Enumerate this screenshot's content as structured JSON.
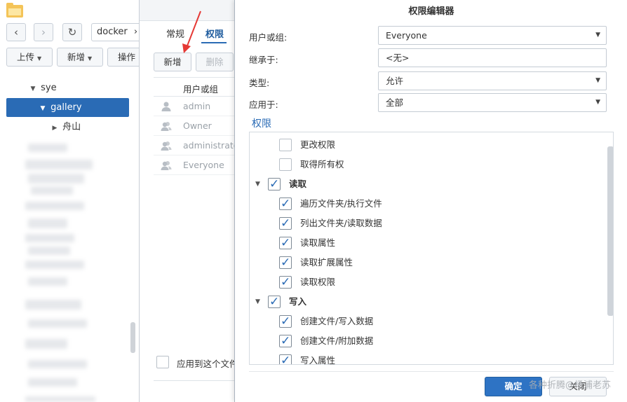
{
  "file_station": {
    "path_text": "docker",
    "path_chevron": "›",
    "back_icon": "‹",
    "forward_icon": "›",
    "refresh_icon": "↻",
    "toolbar": {
      "upload_label": "上传",
      "new_label": "新增",
      "action_label": "操作"
    },
    "tree": [
      {
        "label": "sye",
        "expanded": true
      },
      {
        "label": "gallery",
        "expanded": true,
        "selected": true
      },
      {
        "label": "舟山",
        "expanded": false
      }
    ]
  },
  "property_window": {
    "tabs": [
      {
        "label": "常规"
      },
      {
        "label": "权限",
        "active": true
      }
    ],
    "buttons": {
      "add_label": "新增",
      "delete_label": "删除"
    },
    "column_header": "用户或组",
    "users": [
      "admin",
      "Owner",
      "administrato",
      "Everyone"
    ],
    "apply_label": "应用到这个文件"
  },
  "permission_editor": {
    "title": "权限编辑器",
    "fields": {
      "user_or_group": {
        "label": "用户或组:",
        "value": "Everyone"
      },
      "inherit_from": {
        "label": "继承于:",
        "value": "<无>"
      },
      "type": {
        "label": "类型:",
        "value": "允许"
      },
      "apply_to": {
        "label": "应用于:",
        "value": "全部"
      }
    },
    "section_title": "权限",
    "permissions": [
      {
        "label": "更改权限",
        "checked": false,
        "group": false
      },
      {
        "label": "取得所有权",
        "checked": false,
        "group": false
      },
      {
        "label": "读取",
        "checked": true,
        "group": true
      },
      {
        "label": "遍历文件夹/执行文件",
        "checked": true,
        "group": false
      },
      {
        "label": "列出文件夹/读取数据",
        "checked": true,
        "group": false
      },
      {
        "label": "读取属性",
        "checked": true,
        "group": false
      },
      {
        "label": "读取扩展属性",
        "checked": true,
        "group": false
      },
      {
        "label": "读取权限",
        "checked": true,
        "group": false
      },
      {
        "label": "写入",
        "checked": true,
        "group": true
      },
      {
        "label": "创建文件/写入数据",
        "checked": true,
        "group": false
      },
      {
        "label": "创建文件/附加数据",
        "checked": true,
        "group": false
      },
      {
        "label": "写入属性",
        "checked": true,
        "group": false
      }
    ],
    "footer": {
      "ok_label": "确定",
      "close_label": "关闭"
    },
    "watermark": "各种折腾@杨浦老苏"
  },
  "colors": {
    "accent": "#2a6bb5",
    "ok_button": "#2e73c4",
    "annotation_arrow": "#e53935"
  }
}
